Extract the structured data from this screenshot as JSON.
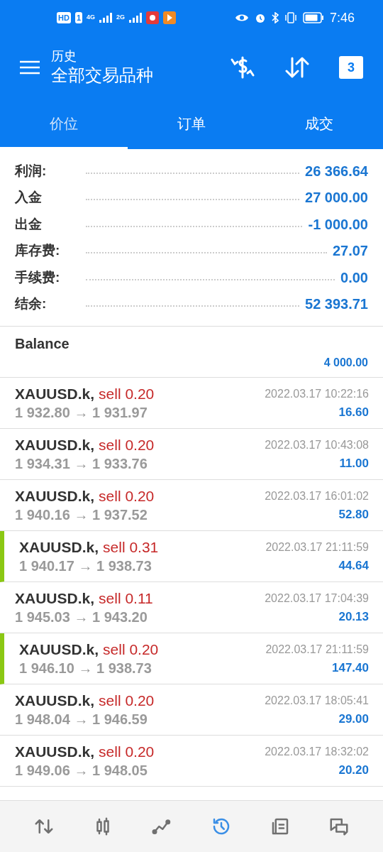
{
  "status_bar": {
    "network_labels": [
      "HD",
      "1",
      "4G",
      "2G"
    ],
    "time": "7:46"
  },
  "header": {
    "subtitle": "历史",
    "title": "全部交易品种",
    "calendar_day": "3"
  },
  "tabs": [
    {
      "label": "价位",
      "selected": true
    },
    {
      "label": "订单",
      "selected": false
    },
    {
      "label": "成交",
      "selected": false
    }
  ],
  "summary": [
    {
      "label": "利润:",
      "value": "26 366.64"
    },
    {
      "label": "入金",
      "value": "27 000.00"
    },
    {
      "label": "出金",
      "value": "-1 000.00"
    },
    {
      "label": "库存费:",
      "value": "27.07"
    },
    {
      "label": "手续费:",
      "value": "0.00"
    },
    {
      "label": "结余:",
      "value": "52 393.71"
    }
  ],
  "balance": {
    "label": "Balance",
    "amount": "4 000.00"
  },
  "deals": [
    {
      "symbol": "XAUUSD.k,",
      "side": "sell 0.20",
      "prices": "1 932.80 → 1 931.97",
      "time": "2022.03.17 10:22:16",
      "profit": "16.60",
      "marked": false
    },
    {
      "symbol": "XAUUSD.k,",
      "side": "sell 0.20",
      "prices": "1 934.31 → 1 933.76",
      "time": "2022.03.17 10:43:08",
      "profit": "11.00",
      "marked": false
    },
    {
      "symbol": "XAUUSD.k,",
      "side": "sell 0.20",
      "prices": "1 940.16 → 1 937.52",
      "time": "2022.03.17 16:01:02",
      "profit": "52.80",
      "marked": false
    },
    {
      "symbol": "XAUUSD.k,",
      "side": "sell 0.31",
      "prices": "1 940.17 → 1 938.73",
      "time": "2022.03.17 21:11:59",
      "profit": "44.64",
      "marked": true
    },
    {
      "symbol": "XAUUSD.k,",
      "side": "sell 0.11",
      "prices": "1 945.03 → 1 943.20",
      "time": "2022.03.17 17:04:39",
      "profit": "20.13",
      "marked": false
    },
    {
      "symbol": "XAUUSD.k,",
      "side": "sell 0.20",
      "prices": "1 946.10 → 1 938.73",
      "time": "2022.03.17 21:11:59",
      "profit": "147.40",
      "marked": true
    },
    {
      "symbol": "XAUUSD.k,",
      "side": "sell 0.20",
      "prices": "1 948.04 → 1 946.59",
      "time": "2022.03.17 18:05:41",
      "profit": "29.00",
      "marked": false
    },
    {
      "symbol": "XAUUSD.k,",
      "side": "sell 0.20",
      "prices": "1 949.06 → 1 948.05",
      "time": "2022.03.17 18:32:02",
      "profit": "20.20",
      "marked": false
    }
  ],
  "bottom_nav": [
    {
      "kind": "quotes",
      "selected": false
    },
    {
      "kind": "chart",
      "selected": false
    },
    {
      "kind": "trade",
      "selected": false
    },
    {
      "kind": "history",
      "selected": true
    },
    {
      "kind": "news",
      "selected": false
    },
    {
      "kind": "chat",
      "selected": false
    }
  ]
}
